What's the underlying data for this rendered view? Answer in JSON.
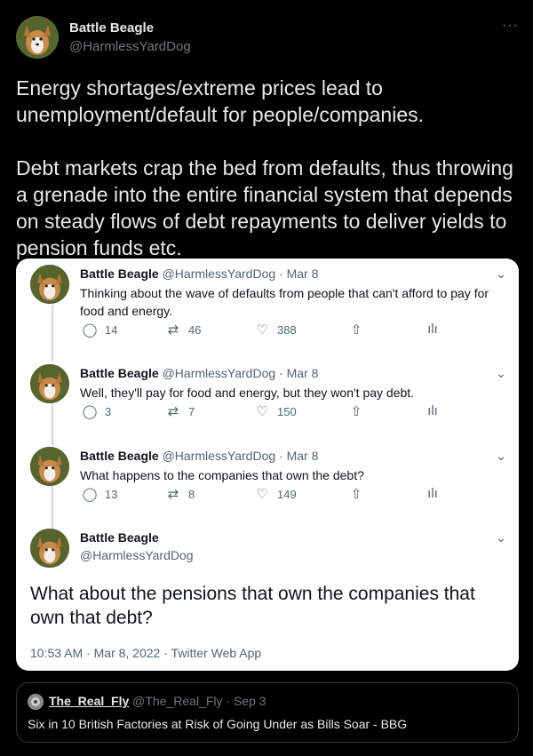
{
  "tweet": {
    "author_name": "Battle Beagle",
    "author_handle": "@HarmlessYardDog",
    "more_icon": "more-horizontal-icon",
    "paragraph1": "Energy shortages/extreme prices lead to unemployment/default for people/companies.",
    "paragraph2": "Debt markets crap the bed from defaults, thus throwing a grenade into the entire financial system that depends on steady flows of debt repayments to deliver yields to pension funds etc."
  },
  "quoted_thread": [
    {
      "name": "Battle Beagle",
      "handle_date": "@HarmlessYardDog · Mar 8",
      "text": "Thinking about the wave of defaults from people that can't afford to pay for food and energy.",
      "replies": "14",
      "retweets": "46",
      "likes": "388"
    },
    {
      "name": "Battle Beagle",
      "handle_date": "@HarmlessYardDog · Mar 8",
      "text": "Well, they'll pay for food and energy, but they won't pay debt.",
      "replies": "3",
      "retweets": "7",
      "likes": "150"
    },
    {
      "name": "Battle Beagle",
      "handle_date": "@HarmlessYardDog · Mar 8",
      "text": "What happens to the companies that own the debt?",
      "replies": "13",
      "retweets": "8",
      "likes": "149"
    }
  ],
  "final_tweet": {
    "name": "Battle Beagle",
    "handle": "@HarmlessYardDog",
    "text": "What about the pensions that own the companies that own that debt?",
    "timestamp": "10:53 AM · Mar 8, 2022 · Twitter Web App"
  },
  "nested_quote": {
    "name": "The_Real_Fly",
    "handle_date": "@The_Real_Fly · Sep 3",
    "text": "Six in 10 British Factories at Risk of Going Under as Bills Soar - BBG"
  },
  "colors": {
    "background": "#000000",
    "card": "#ffffff",
    "muted": "#536471"
  }
}
